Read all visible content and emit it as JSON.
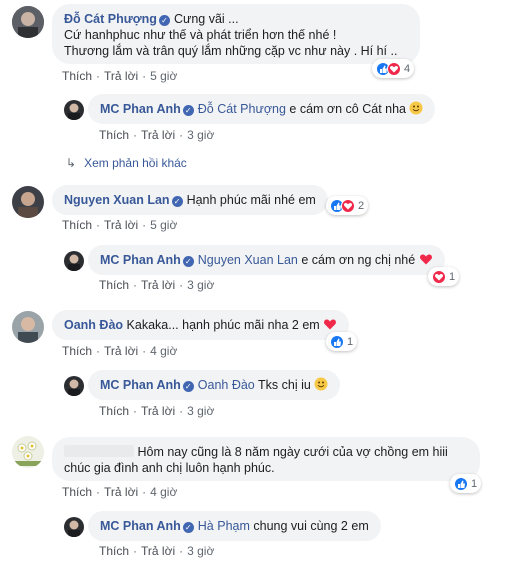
{
  "comments": [
    {
      "author": "Đỗ Cát Phượng",
      "lines": [
        "Cưng vãi ...",
        "Cứ hanhphuc như thế và phát triển hơn thế nhé !",
        "Thương lắm và trân quý lắm những cặp vc như này . Hí hí .."
      ],
      "like": "Thích",
      "reply": "Trả lời",
      "time": "5 giờ",
      "reactions": "4"
    },
    {
      "author": "MC Phan Anh",
      "tag": "Đỗ Cát Phượng",
      "text": "e cám ơn cô Cát nha",
      "like": "Thích",
      "reply": "Trả lời",
      "time": "3 giờ"
    },
    {
      "author": "Nguyen Xuan Lan",
      "text": "Hạnh phúc mãi nhé em",
      "like": "Thích",
      "reply": "Trả lời",
      "time": "5 giờ",
      "reactions": "2"
    },
    {
      "author": "MC Phan Anh",
      "tag": "Nguyen Xuan Lan",
      "text": "e cám ơn ng chị nhé",
      "like": "Thích",
      "reply": "Trả lời",
      "time": "3 giờ",
      "reactions": "1"
    },
    {
      "author": "Oanh Đào",
      "text": "Kakaka... hạnh phúc mãi nha 2 em",
      "like": "Thích",
      "reply": "Trả lời",
      "time": "4 giờ",
      "reactions": "1"
    },
    {
      "author": "MC Phan Anh",
      "tag": "Oanh Đào",
      "text": "Tks chị iu",
      "like": "Thích",
      "reply": "Trả lời",
      "time": "3 giờ"
    },
    {
      "lines": [
        "Hôm nay cũng là 8 năm ngày cưới của vợ chồng em hiii",
        "chúc gia đình anh chị luôn hạnh phúc."
      ],
      "like": "Thích",
      "reply": "Trả lời",
      "time": "4 giờ",
      "reactions": "1"
    },
    {
      "author": "MC Phan Anh",
      "tag": "Hà Phạm",
      "text": "chung vui cùng 2 em",
      "like": "Thích",
      "reply": "Trả lời",
      "time": "3 giờ"
    }
  ],
  "more_replies": "Xem phản hồi khác",
  "colors": {
    "link": "#385898",
    "bubble": "#f2f3f5",
    "like": "#1877f2",
    "love": "#f0284a"
  }
}
